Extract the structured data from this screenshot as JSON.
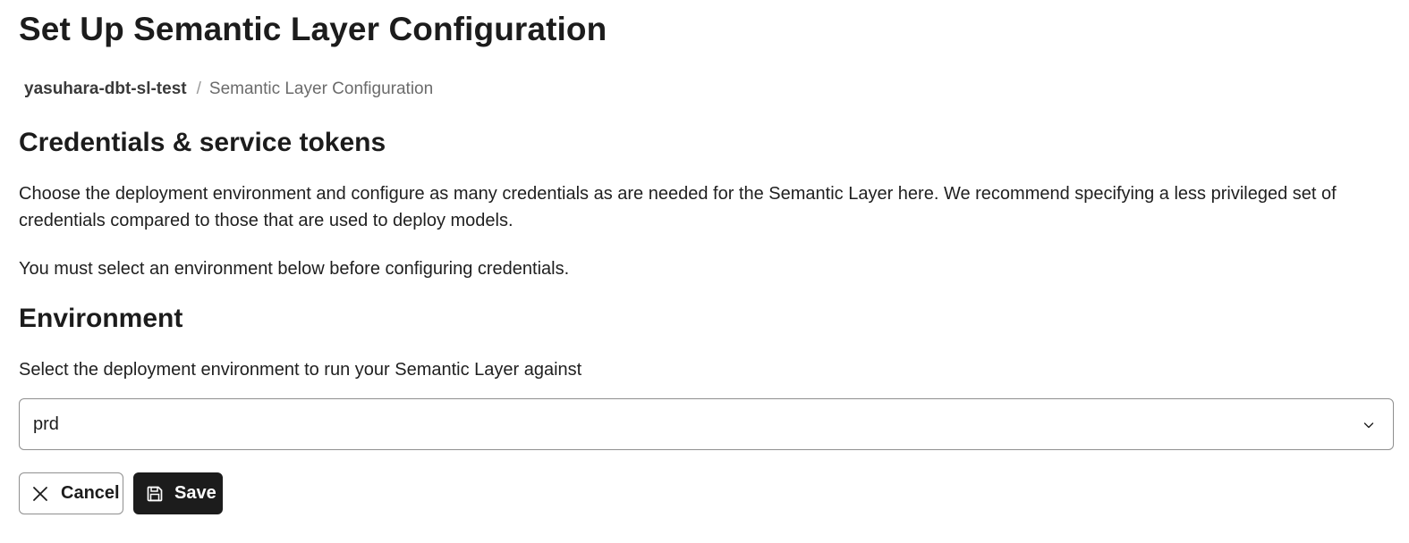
{
  "page": {
    "title": "Set Up Semantic Layer Configuration"
  },
  "breadcrumb": {
    "project": "yasuhara-dbt-sl-test",
    "separator": "/",
    "current": "Semantic Layer Configuration"
  },
  "credentials": {
    "heading": "Credentials & service tokens",
    "description": "Choose the deployment environment and configure as many credentials as are needed for the Semantic Layer here. We recommend specifying a less privileged set of credentials compared to those that are used to deploy models.",
    "notice": "You must select an environment below before configuring credentials."
  },
  "environment": {
    "heading": "Environment",
    "description": "Select the deployment environment to run your Semantic Layer against",
    "selected": "prd"
  },
  "actions": {
    "cancel_label": "Cancel",
    "save_label": "Save"
  },
  "icons": {
    "chevron": "chevron-down-icon",
    "cancel": "close-icon",
    "save": "floppy-disk-icon"
  },
  "colors": {
    "text": "#1c1c1c",
    "muted": "#6b6b6b",
    "border": "#8f8f8f",
    "primary_button": "#1c1c1c"
  }
}
